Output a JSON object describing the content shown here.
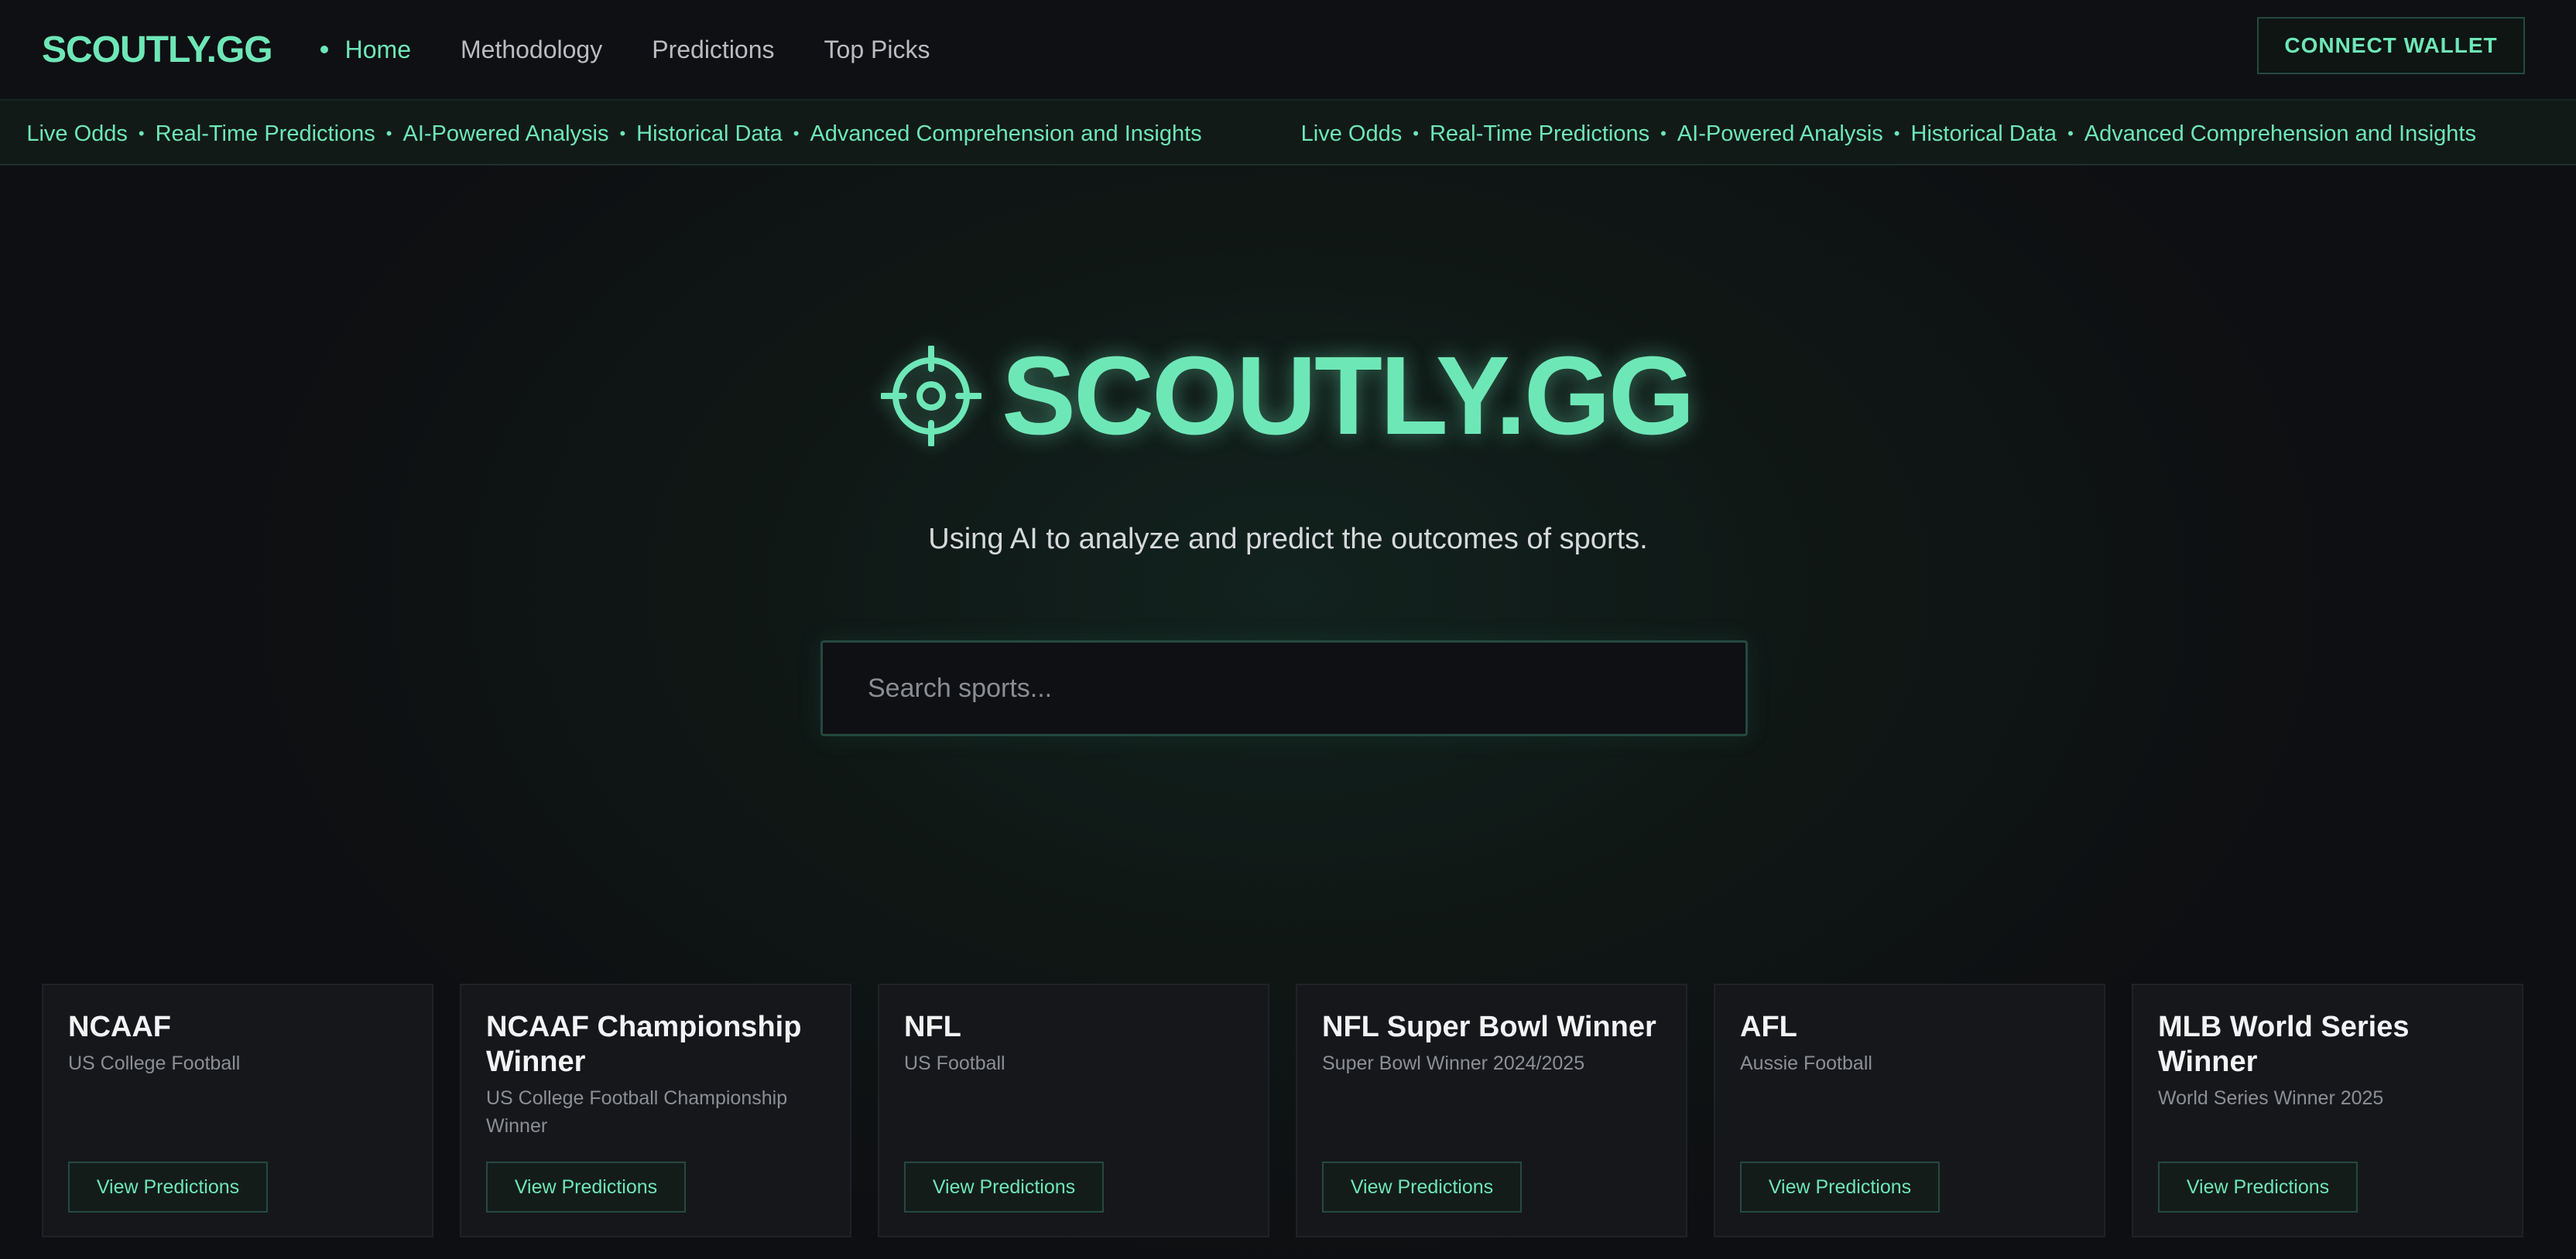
{
  "nav": {
    "brand": "SCOUTLY.GG",
    "links": [
      "Home",
      "Methodology",
      "Predictions",
      "Top Picks"
    ],
    "connect_wallet": "CONNECT WALLET"
  },
  "ticker": {
    "items": [
      "Live Odds",
      "Real-Time Predictions",
      "AI-Powered Analysis",
      "Historical Data",
      "Advanced Comprehension and Insights"
    ],
    "separator": "•"
  },
  "hero": {
    "title": "SCOUTLY.GG",
    "icon": "crosshair-target-icon",
    "tagline": "Using AI to analyze and predict the outcomes of sports."
  },
  "search": {
    "placeholder": "Search sports..."
  },
  "cards": [
    {
      "title": "NCAAF",
      "subtitle": "US College Football",
      "button": "View Predictions"
    },
    {
      "title": "NCAAF Championship Winner",
      "subtitle": "US College Football Championship Winner",
      "button": "View Predictions"
    },
    {
      "title": "NFL",
      "subtitle": "US Football",
      "button": "View Predictions"
    },
    {
      "title": "NFL Super Bowl Winner",
      "subtitle": "Super Bowl Winner 2024/2025",
      "button": "View Predictions"
    },
    {
      "title": "AFL",
      "subtitle": "Aussie Football",
      "button": "View Predictions"
    },
    {
      "title": "MLB World Series Winner",
      "subtitle": "World Series Winner 2025",
      "button": "View Predictions"
    }
  ],
  "colors": {
    "accent": "#6ee7b7",
    "background": "#0e0f12",
    "card": "#16171b"
  }
}
